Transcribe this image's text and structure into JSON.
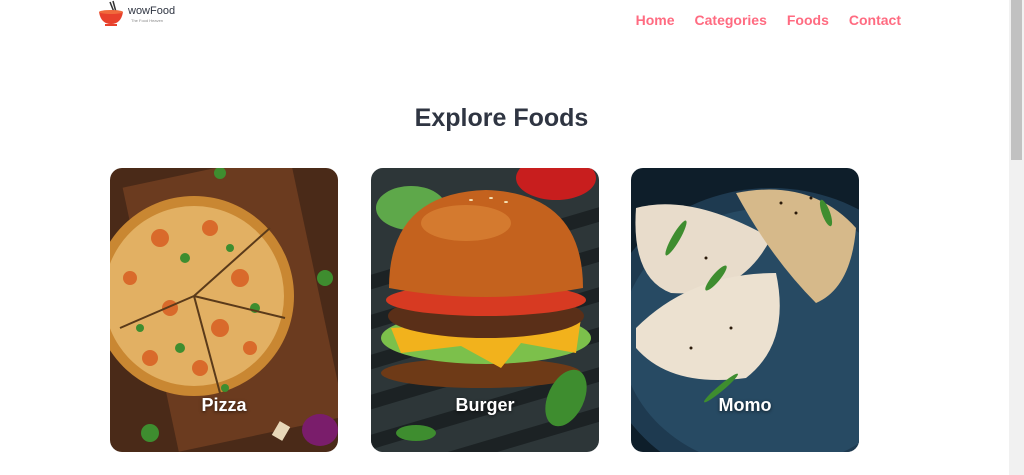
{
  "brand": {
    "name": "wowFood",
    "tagline": "The Food Heaven",
    "accent_color": "#ff6b81"
  },
  "nav": {
    "items": [
      {
        "label": "Home"
      },
      {
        "label": "Categories"
      },
      {
        "label": "Foods"
      },
      {
        "label": "Contact"
      }
    ]
  },
  "main": {
    "heading": "Explore Foods",
    "categories": [
      {
        "title": "Pizza",
        "image": "pizza-image"
      },
      {
        "title": "Burger",
        "image": "burger-image"
      },
      {
        "title": "Momo",
        "image": "momo-image"
      }
    ]
  }
}
